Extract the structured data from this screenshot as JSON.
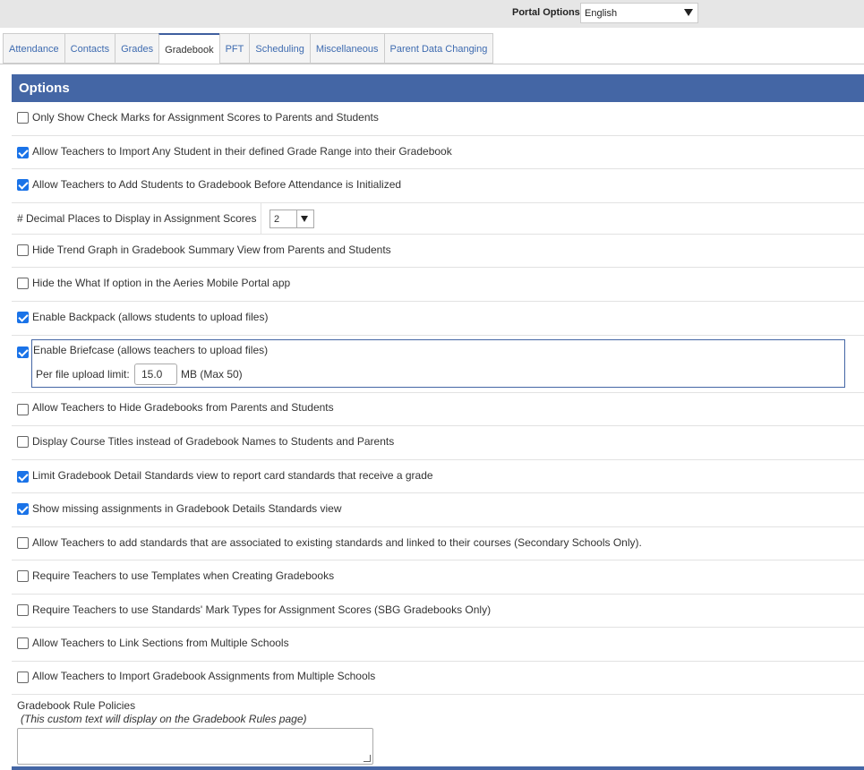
{
  "portal": {
    "label": "Portal Options:",
    "value": "English"
  },
  "tabs": [
    "Attendance",
    "Contacts",
    "Grades",
    "Gradebook",
    "PFT",
    "Scheduling",
    "Miscellaneous",
    "Parent Data Changing"
  ],
  "active_tab": "Gradebook",
  "section": {
    "title": "Options"
  },
  "options": [
    {
      "label": "Only Show Check Marks for Assignment Scores to Parents and Students",
      "checked": false
    },
    {
      "label": "Allow Teachers to Import Any Student in their defined Grade Range into their Gradebook",
      "checked": true
    },
    {
      "label": "Allow Teachers to Add Students to Gradebook Before Attendance is Initialized",
      "checked": true
    },
    {
      "label": "Hide Trend Graph in Gradebook Summary View from Parents and Students",
      "checked": false
    },
    {
      "label": "Hide the What If option in the Aeries Mobile Portal app",
      "checked": false
    },
    {
      "label": "Enable Backpack (allows students to upload files)",
      "checked": true
    },
    {
      "label": "Enable Briefcase (allows teachers to upload files)",
      "checked": true
    },
    {
      "label": "Allow Teachers to Hide Gradebooks from Parents and Students",
      "checked": false
    },
    {
      "label": "Display Course Titles instead of Gradebook Names to Students and Parents",
      "checked": false
    },
    {
      "label": "Limit Gradebook Detail Standards view to report card standards that receive a grade",
      "checked": true
    },
    {
      "label": "Show missing assignments in Gradebook Details Standards view",
      "checked": true
    },
    {
      "label": "Allow Teachers to add standards that are associated to existing standards and linked to their courses (Secondary Schools Only).",
      "checked": false
    },
    {
      "label": "Require Teachers to use Templates when Creating Gradebooks",
      "checked": false
    },
    {
      "label": "Require Teachers to use Standards' Mark Types for Assignment Scores (SBG Gradebooks Only)",
      "checked": false
    },
    {
      "label": "Allow Teachers to Link Sections from Multiple Schools",
      "checked": false
    },
    {
      "label": "Allow Teachers to Import Gradebook Assignments from Multiple Schools",
      "checked": false
    }
  ],
  "decimal": {
    "label": "# Decimal Places to Display in Assignment Scores",
    "value": "2"
  },
  "briefcase": {
    "limit_label": "Per file upload limit:",
    "limit_value": "15.0",
    "limit_max": "MB (Max 50)"
  },
  "rules": {
    "title": "Gradebook Rule Policies",
    "note": "(This custom text will display on the Gradebook Rules page)",
    "text": ""
  }
}
